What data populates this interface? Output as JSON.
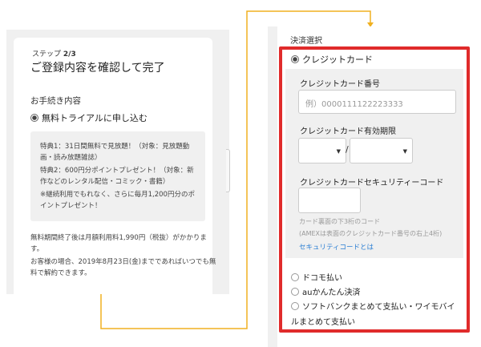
{
  "left": {
    "step_prefix": "ステップ",
    "step_value": "2/3",
    "title": "ご登録内容を確認して完了",
    "section_label": "お手続き内容",
    "plan_option": "無料トライアルに申し込む",
    "benefits": [
      "特典1：31日間無料で見放題！（対象：見放題動画・読み放題雑誌）",
      "特典2：600円分ポイントプレゼント！（対象：新作などのレンタル配信・コミック・書籍）",
      "※継続利用でもれなく、さらに毎月1,200円分のポイントプレゼント！"
    ],
    "notes": [
      "無料期間終了後は月額利用料1,990円（税抜）がかかります。",
      "お客様の場合、2019年8月23日(金)までであればいつでも無料で解約できます。"
    ]
  },
  "right": {
    "payment_title": "決済選択",
    "credit_card": "クレジットカード",
    "card_number_label": "クレジットカード番号",
    "card_number_placeholder": "例）0000111122223333",
    "expiry_label": "クレジットカード有効期限",
    "expiry_separator": "/",
    "security_label": "クレジットカードセキュリティーコード",
    "security_hint_1": "カード裏面の下3桁のコード",
    "security_hint_2": "(AMEXは表面のクレジットカード番号の右上4桁)",
    "security_link": "セキュリティコードとは",
    "docomo": "ドコモ払い",
    "au": "auかんたん決済",
    "softbank_line1": "ソフトバンクまとめて支払い・ワイモバイ",
    "softbank_line2": "ルまとめて支払い"
  },
  "colors": {
    "highlight_border": "#e02b2b",
    "connector": "#f0b020",
    "link": "#2a7ed3"
  }
}
